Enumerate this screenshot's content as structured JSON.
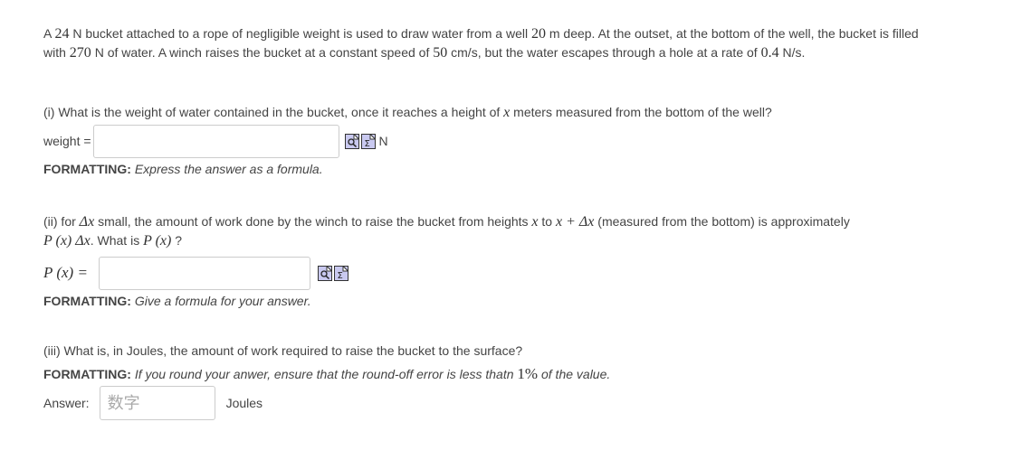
{
  "intro": {
    "t1": "A",
    "weight_bucket": "24",
    "t2": "N bucket attached to a rope of negligible weight is used to draw water from a well",
    "depth": "20",
    "t3": "m deep. At the outset, at the bottom of the well, the bucket is filled",
    "t4": "with",
    "water": "270",
    "t5": "N of water. A winch raises the bucket at a constant speed of",
    "speed": "50",
    "t6": "cm/s, but the water escapes through a hole at a rate of",
    "rate": "0.4",
    "t7": "N/s."
  },
  "part1": {
    "q1": "(i) What is the weight of water contained in the bucket, once it reaches a height of",
    "var_x": "x",
    "q2": "meters measured from the bottom of the well?",
    "label": "weight =",
    "input_value": "",
    "unit": "N",
    "fmt_label": "FORMATTING:",
    "fmt_text": "Express the answer as a formula."
  },
  "part2": {
    "q1": "(ii) for",
    "dx": "Δx",
    "q2": "small, the amount of work done by the winch to raise the bucket from heights",
    "x1": "x",
    "q3": "to",
    "xdx": "x + Δx",
    "q4": "(measured from the bottom) is approximately",
    "px_dx": "P (x) Δx",
    "q5": ". What is",
    "px": "P (x)",
    "q6": "?",
    "label": "P (x) =",
    "input_value": "",
    "fmt_label": "FORMATTING:",
    "fmt_text": "Give a formula for your answer."
  },
  "part3": {
    "question": "(iii) What is, in Joules, the amount of work required to raise the bucket to the surface?",
    "fmt_label": "FORMATTING:",
    "fmt_text1": "If you round your anwer, ensure that the round-off error is less thatn",
    "pct": "1%",
    "fmt_text2": "of the value.",
    "label": "Answer:",
    "placeholder": "数字",
    "unit": "Joules"
  },
  "icons": [
    "preview-icon",
    "equation-editor-icon"
  ]
}
